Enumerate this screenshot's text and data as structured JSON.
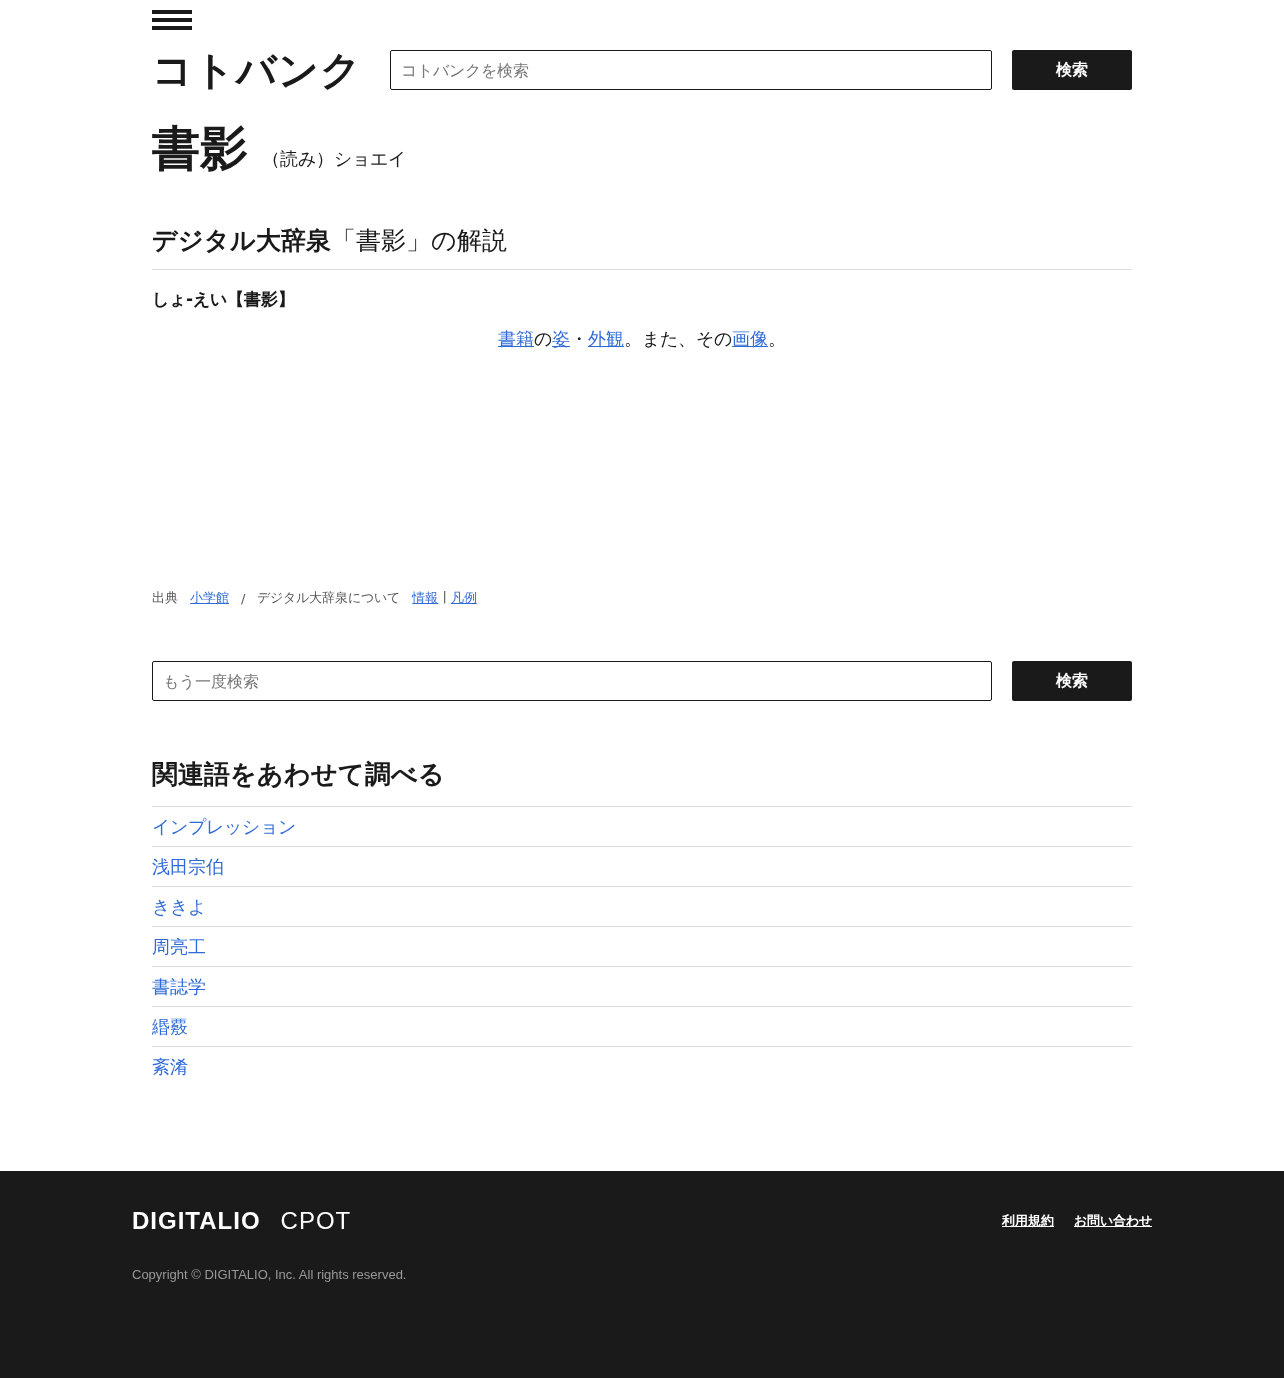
{
  "header": {
    "logo": "コトバンク",
    "search": {
      "placeholder": "コトバンクを検索",
      "button": "検索"
    }
  },
  "entry": {
    "title": "書影",
    "reading": "（読み）ショエイ"
  },
  "section": {
    "dictionary": "デジタル大辞泉",
    "heading_rest": "「書影」の解説",
    "headword": "しょ-えい【書影】",
    "definition": [
      {
        "kind": "link",
        "text": "書籍"
      },
      {
        "kind": "text",
        "text": "の"
      },
      {
        "kind": "link",
        "text": "姿"
      },
      {
        "kind": "text",
        "text": "・"
      },
      {
        "kind": "link",
        "text": "外観"
      },
      {
        "kind": "text",
        "text": "。また、その"
      },
      {
        "kind": "link",
        "text": "画像"
      },
      {
        "kind": "text",
        "text": "。"
      }
    ]
  },
  "source": {
    "label": "出典",
    "publisher": "小学館",
    "separator": "/",
    "about": "デジタル大辞泉について",
    "info": "情報",
    "pipe": "|",
    "legend": "凡例"
  },
  "search_again": {
    "placeholder": "もう一度検索",
    "button": "検索"
  },
  "related": {
    "heading": "関連語をあわせて調べる",
    "items": [
      "インプレッション",
      "浅田宗伯",
      "ききよ",
      "周亮工",
      "書誌学",
      "緡覈",
      "紊淆"
    ]
  },
  "footer": {
    "logos": [
      "DIGITALIO",
      "CPOT"
    ],
    "links": [
      "利用規約",
      "お問い合わせ"
    ],
    "copyright": "Copyright © DIGITALIO, Inc. All rights reserved."
  }
}
